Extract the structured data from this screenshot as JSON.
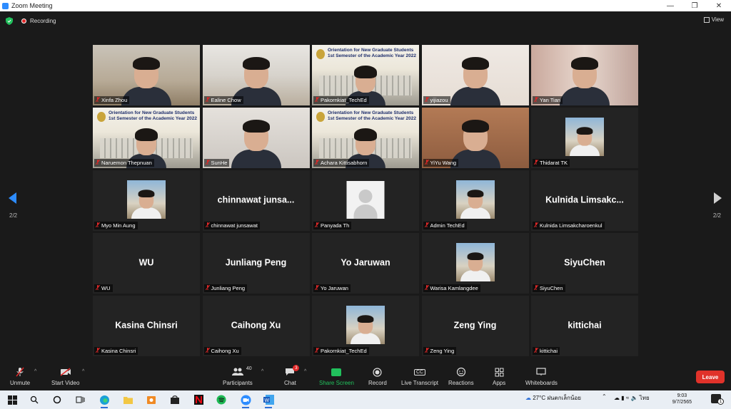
{
  "window": {
    "title": "Zoom Meeting"
  },
  "topbar": {
    "recording_label": "Recording",
    "view_label": "View"
  },
  "pager": {
    "left": "2/2",
    "right": "2/2"
  },
  "tiles": [
    {
      "name": "Xinfa Zhou",
      "kind": "video",
      "bg": "room1"
    },
    {
      "name": "Ealine Chow",
      "kind": "video",
      "bg": "room2"
    },
    {
      "name": "Pakornkiat_TechEd",
      "kind": "slide",
      "slide_title": "Orientation for New Graduate Students 1st Semester of the Academic Year 2022"
    },
    {
      "name": "yijiazou",
      "kind": "video",
      "bg": "room3"
    },
    {
      "name": "Yan Tian",
      "kind": "video",
      "bg": "room4"
    },
    {
      "name": "Naruemon Thepnuan",
      "kind": "slide",
      "slide_title": "Orientation for New Graduate Students 1st Semester of the Academic Year 2022"
    },
    {
      "name": "SunHe",
      "kind": "video",
      "bg": "room5"
    },
    {
      "name": "Achara Kittisabhorn",
      "kind": "slide",
      "slide_title": "Orientation for New Graduate Students 1st Semester of the Academic Year 2022"
    },
    {
      "name": "YiYu Wang",
      "kind": "video",
      "bg": "room6"
    },
    {
      "name": "Thidarat TK",
      "kind": "photo"
    },
    {
      "name": "Myo Min Aung",
      "kind": "photo"
    },
    {
      "name": "chinnawat junsawat",
      "kind": "text",
      "display": "chinnawat  junsa..."
    },
    {
      "name": "Panyada Th",
      "kind": "placeholder"
    },
    {
      "name": "Admin TechEd",
      "kind": "photo"
    },
    {
      "name": "Kulnida Limsakcharoenkul",
      "kind": "text",
      "display": "Kulnida  Limsakc..."
    },
    {
      "name": "WU",
      "kind": "text",
      "display": "WU"
    },
    {
      "name": "Junliang Peng",
      "kind": "text",
      "display": "Junliang Peng"
    },
    {
      "name": "Yo Jaruwan",
      "kind": "text",
      "display": "Yo Jaruwan"
    },
    {
      "name": "Warisa Kamlangdee",
      "kind": "photo"
    },
    {
      "name": "SiyuChen",
      "kind": "text",
      "display": "SiyuChen"
    },
    {
      "name": "Kasina Chinsri",
      "kind": "text",
      "display": "Kasina Chinsri"
    },
    {
      "name": "Caihong Xu",
      "kind": "text",
      "display": "Caihong Xu"
    },
    {
      "name": "Pakornkiat_TechEd",
      "kind": "photo"
    },
    {
      "name": "Zeng Ying",
      "kind": "text",
      "display": "Zeng Ying"
    },
    {
      "name": "kittichai",
      "kind": "text",
      "display": "kittichai"
    }
  ],
  "toolbar": {
    "unmute": "Unmute",
    "start_video": "Start Video",
    "participants": "Participants",
    "participants_count": "40",
    "chat": "Chat",
    "chat_badge": "3",
    "share_screen": "Share Screen",
    "record": "Record",
    "live_transcript": "Live Transcript",
    "live_transcript_icon": "CC",
    "reactions": "Reactions",
    "apps": "Apps",
    "whiteboards": "Whiteboards",
    "leave": "Leave"
  },
  "taskbar": {
    "weather": "27°C",
    "weather_desc": "ฝนตกเล็กน้อย",
    "lang": "ไทย",
    "time": "9:03",
    "date": "9/7/2565",
    "notifications": "1"
  },
  "colors": {
    "accent": "#2d8cff",
    "leave": "#e0322a",
    "share": "#21c05c",
    "muted": "#e02828"
  }
}
